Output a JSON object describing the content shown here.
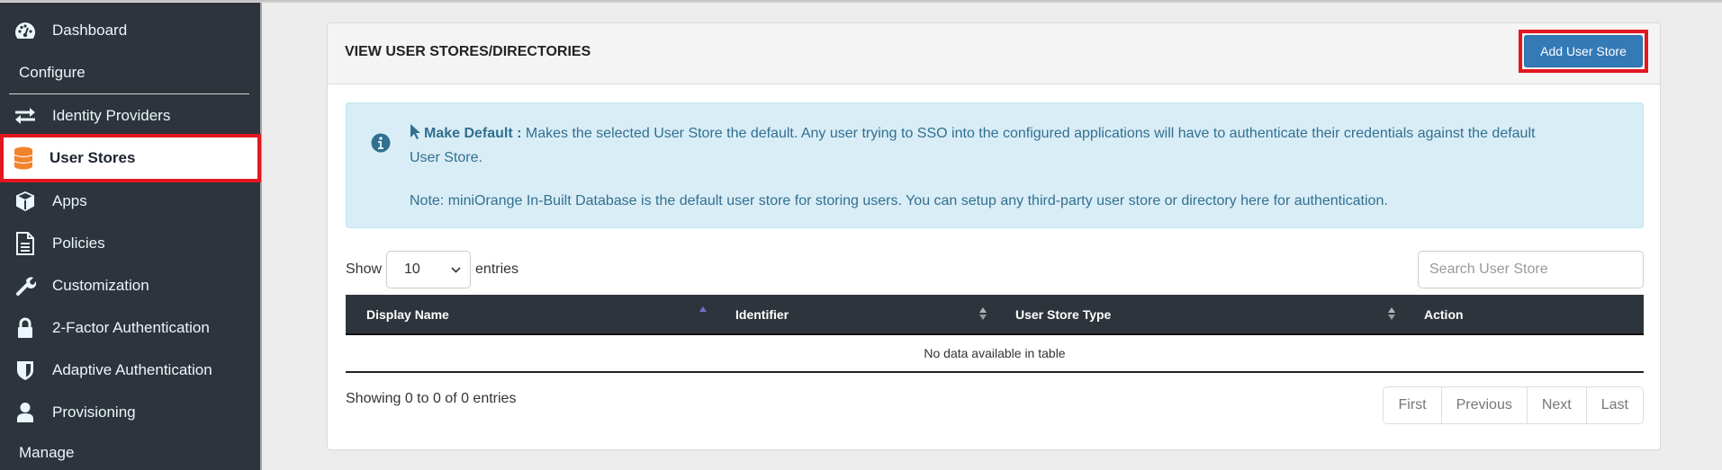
{
  "sidebar": {
    "items": [
      {
        "label": "Dashboard",
        "icon": "dashboard-icon"
      },
      {
        "label": "Identity Providers",
        "icon": "exchange-icon"
      },
      {
        "label": "User Stores",
        "icon": "database-icon",
        "active": true
      },
      {
        "label": "Apps",
        "icon": "cube-icon"
      },
      {
        "label": "Policies",
        "icon": "document-icon"
      },
      {
        "label": "Customization",
        "icon": "wrench-icon"
      },
      {
        "label": "2-Factor Authentication",
        "icon": "lock-icon"
      },
      {
        "label": "Adaptive Authentication",
        "icon": "shield-icon"
      },
      {
        "label": "Provisioning",
        "icon": "user-icon"
      }
    ],
    "sections": {
      "configure": "Configure",
      "manage": "Manage"
    }
  },
  "card": {
    "title": "VIEW USER STORES/DIRECTORIES",
    "add_button": "Add User Store"
  },
  "alert": {
    "bold_label": "Make Default :",
    "text1": " Makes the selected User Store the default. Any user trying to SSO into the configured applications will have to authenticate their credentials against the default User Store.",
    "text2": "Note: miniOrange In-Built Database is the default user store for storing users. You can setup any third-party user store or directory here for authentication."
  },
  "controls": {
    "show_label": "Show",
    "entries_label": "entries",
    "page_size": "10",
    "search_placeholder": "Search User Store"
  },
  "table": {
    "columns": [
      "Display Name",
      "Identifier",
      "User Store Type",
      "Action"
    ],
    "empty_message": "No data available in table",
    "sort_color": "#6f73c9"
  },
  "footer": {
    "info": "Showing 0 to 0 of 0 entries",
    "pager": [
      "First",
      "Previous",
      "Next",
      "Last"
    ]
  },
  "colors": {
    "sidebar_bg": "#2e343b",
    "highlight": "#e3171f",
    "primary": "#337ab7",
    "alert_bg": "#d9edf7",
    "alert_text": "#31708f",
    "database_icon": "#f0842c"
  }
}
